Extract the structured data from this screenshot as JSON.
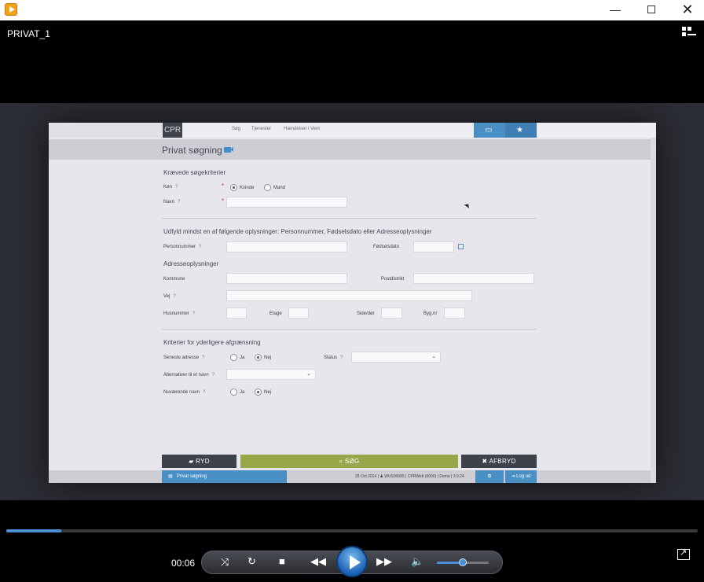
{
  "window": {
    "minimize": "—",
    "maximize": "",
    "close": "✕"
  },
  "player": {
    "title": "PRIVAT_1",
    "time": "00:06",
    "progress_fraction": 0.08,
    "volume_fraction": 0.5
  },
  "cpr": {
    "logo": "CPR",
    "nav": [
      "Søg",
      "Tjenester",
      "Hændelser i Vent"
    ],
    "heading": "Privat søgning",
    "required_section": "Krævede søgekriterier",
    "kon_label": "Køn",
    "kon_options": [
      "Kvinde",
      "Mand"
    ],
    "navn_label": "Navn",
    "info_section": "Udfyld mindst en af følgende oplysninger: Personnummer, Fødselsdato eller Adresseoplysninger",
    "personnummer_label": "Personnummer",
    "fodselsdato_label": "Fødselsdato",
    "address_section": "Adresseoplysninger",
    "kommune_label": "Kommune",
    "postdistrikt_label": "Postdistrikt",
    "vej_label": "Vej",
    "husnummer_label": "Husnummer",
    "etage_label": "Etage",
    "side_label": "Side/dør",
    "byg_label": "Byg.nr",
    "extra_section": "Kriterier for yderligere afgrænsning",
    "seneste_label": "Seneste adresse",
    "ja": "Ja",
    "nej": "Nej",
    "status_label": "Status",
    "alt_navn_label": "Alternativer til et navn",
    "nuv_navn_label": "Nuværende navn",
    "help": "?",
    "req": "*",
    "btn_ryd": "RYD",
    "btn_sog": "SØG",
    "btn_afbryd": "AFBRYD",
    "status_tab": "Privat søgning",
    "status_info": "29 Oct 2014 | ♟ WUS00085 | CPRWeb (0000) | Demo | 3.0.24",
    "logout": "Log ud"
  },
  "icons": [
    "app-icon",
    "print-icon",
    "star-icon",
    "camera-icon",
    "calendar-icon",
    "eraser-icon",
    "search-icon",
    "close-icon",
    "shuffle-icon",
    "repeat-icon",
    "stop-icon",
    "rewind-icon",
    "play-icon",
    "forward-icon",
    "volume-icon",
    "expand-icon"
  ]
}
